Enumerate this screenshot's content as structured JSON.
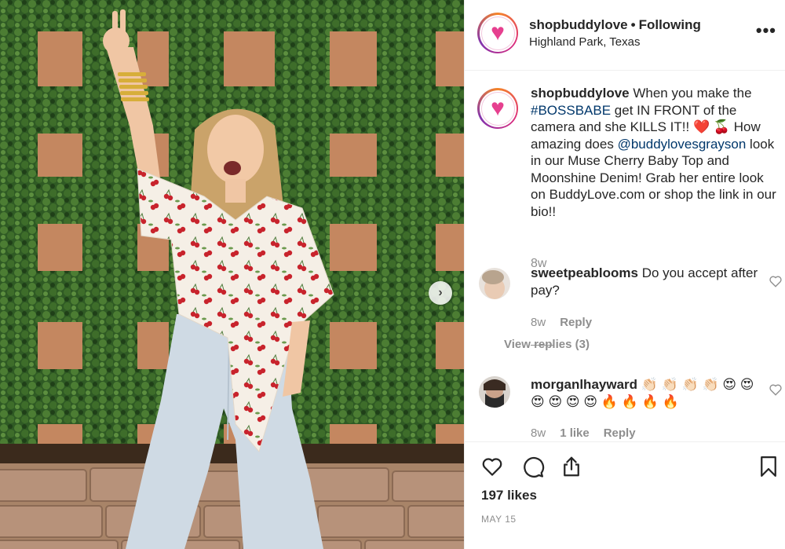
{
  "post": {
    "username": "shopbuddylove",
    "separator": "•",
    "follow_status": "Following",
    "location": "Highland Park, Texas",
    "more_label": "•••",
    "avatar_glyph": "♥",
    "next_glyph": "›"
  },
  "caption": {
    "username": "shopbuddylove",
    "text_1": " When you make the ",
    "hashtag": "#BOSSBABE",
    "text_2": " get IN FRONT of the camera and she KILLS IT!! ❤️ 🍒  How amazing does ",
    "mention": "@buddylovesgrayson",
    "text_3": " look in our Muse Cherry Baby Top and Moonshine Denim! Grab her entire look on BuddyLove.com or shop the link in our bio!!",
    "time": "8w"
  },
  "comments": [
    {
      "username": "sweetpeablooms",
      "text": " Do you accept after pay?",
      "time": "8w",
      "reply_label": "Reply",
      "view_replies": "View replies (3)"
    },
    {
      "username": "morganlhayward",
      "text": " 👏🏻 👏🏻 👏🏻 👏🏻 😍 😍 😍 😍 😍 😍 🔥 🔥 🔥 🔥",
      "time": "8w",
      "likes_label": "1 like",
      "reply_label": "Reply"
    }
  ],
  "footer": {
    "likes": "197 likes",
    "date": "MAY 15"
  },
  "colors": {
    "link": "#00376b",
    "muted": "#8e8e8e",
    "brand_pink": "#e6408f"
  },
  "icons": [
    "heart-icon",
    "comment-icon",
    "share-icon",
    "bookmark-icon",
    "more-options-icon",
    "next-arrow-icon"
  ]
}
